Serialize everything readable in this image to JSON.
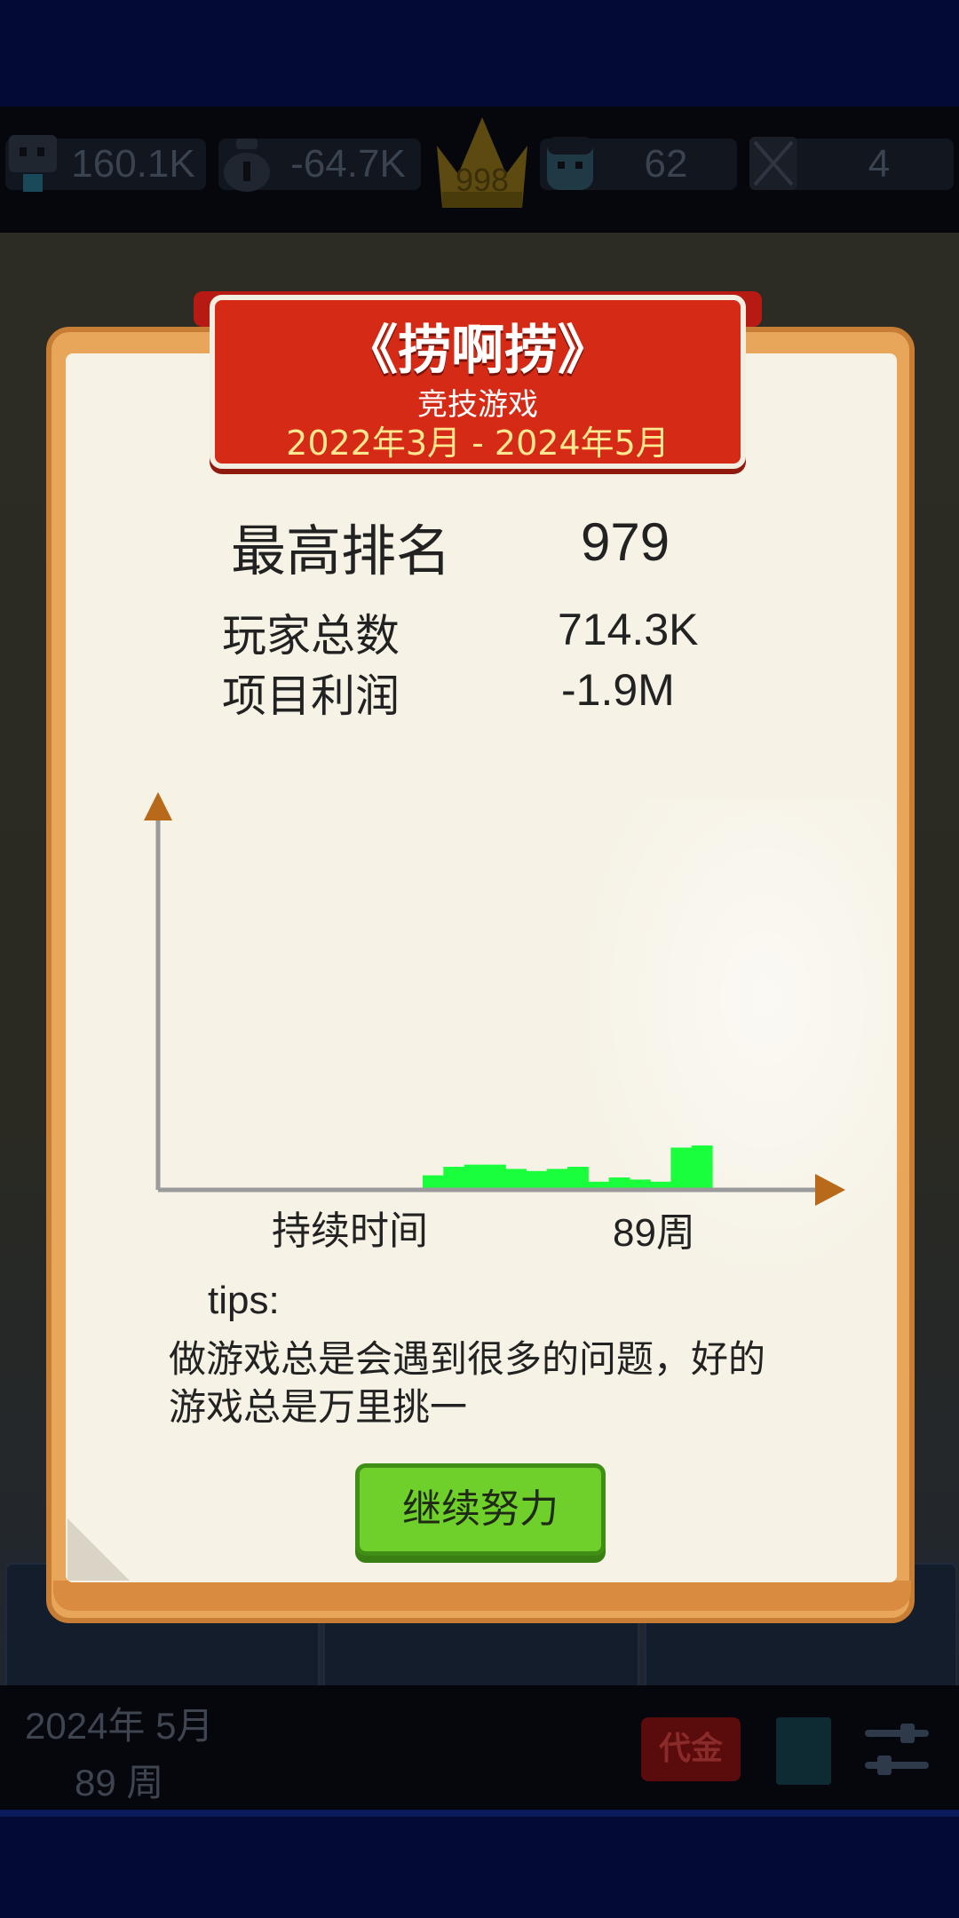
{
  "topbar": {
    "money": "160.1K",
    "profit": "-64.7K",
    "rank": "998",
    "fans": "62",
    "misc": "4"
  },
  "card": {
    "title": "《捞啊捞》",
    "genre": "竞技游戏",
    "date_range": "2022年3月 - 2024年5月",
    "best_rank_label": "最高排名",
    "best_rank_value": "979",
    "players_label": "玩家总数",
    "players_value": "714.3K",
    "profit_label": "项目利润",
    "profit_value": "-1.9M",
    "duration_label": "持续时间",
    "duration_value": "89周",
    "tips_title": "tips:",
    "tips_text_1": "做游戏总是会遇到很多的问题，好的",
    "tips_text_2": "游戏总是万里挑一",
    "continue_button": "继续努力"
  },
  "bottombar": {
    "date": "2024年 5月",
    "week": "89 周",
    "red_button": "代金"
  },
  "chart_data": {
    "type": "area",
    "x": [
      0,
      1,
      2,
      3,
      4,
      5,
      6,
      7,
      8,
      9,
      10,
      11,
      12,
      13
    ],
    "values": [
      0.6,
      1.0,
      1.1,
      1.1,
      0.9,
      0.8,
      0.9,
      1.0,
      0.3,
      0.5,
      0.4,
      0.3,
      1.9,
      2.0
    ],
    "xlabel": "",
    "ylabel": "",
    "colors": {
      "fill": "#1aff3c",
      "axis": "#9a9a9a",
      "arrow": "#b86a1a"
    }
  }
}
